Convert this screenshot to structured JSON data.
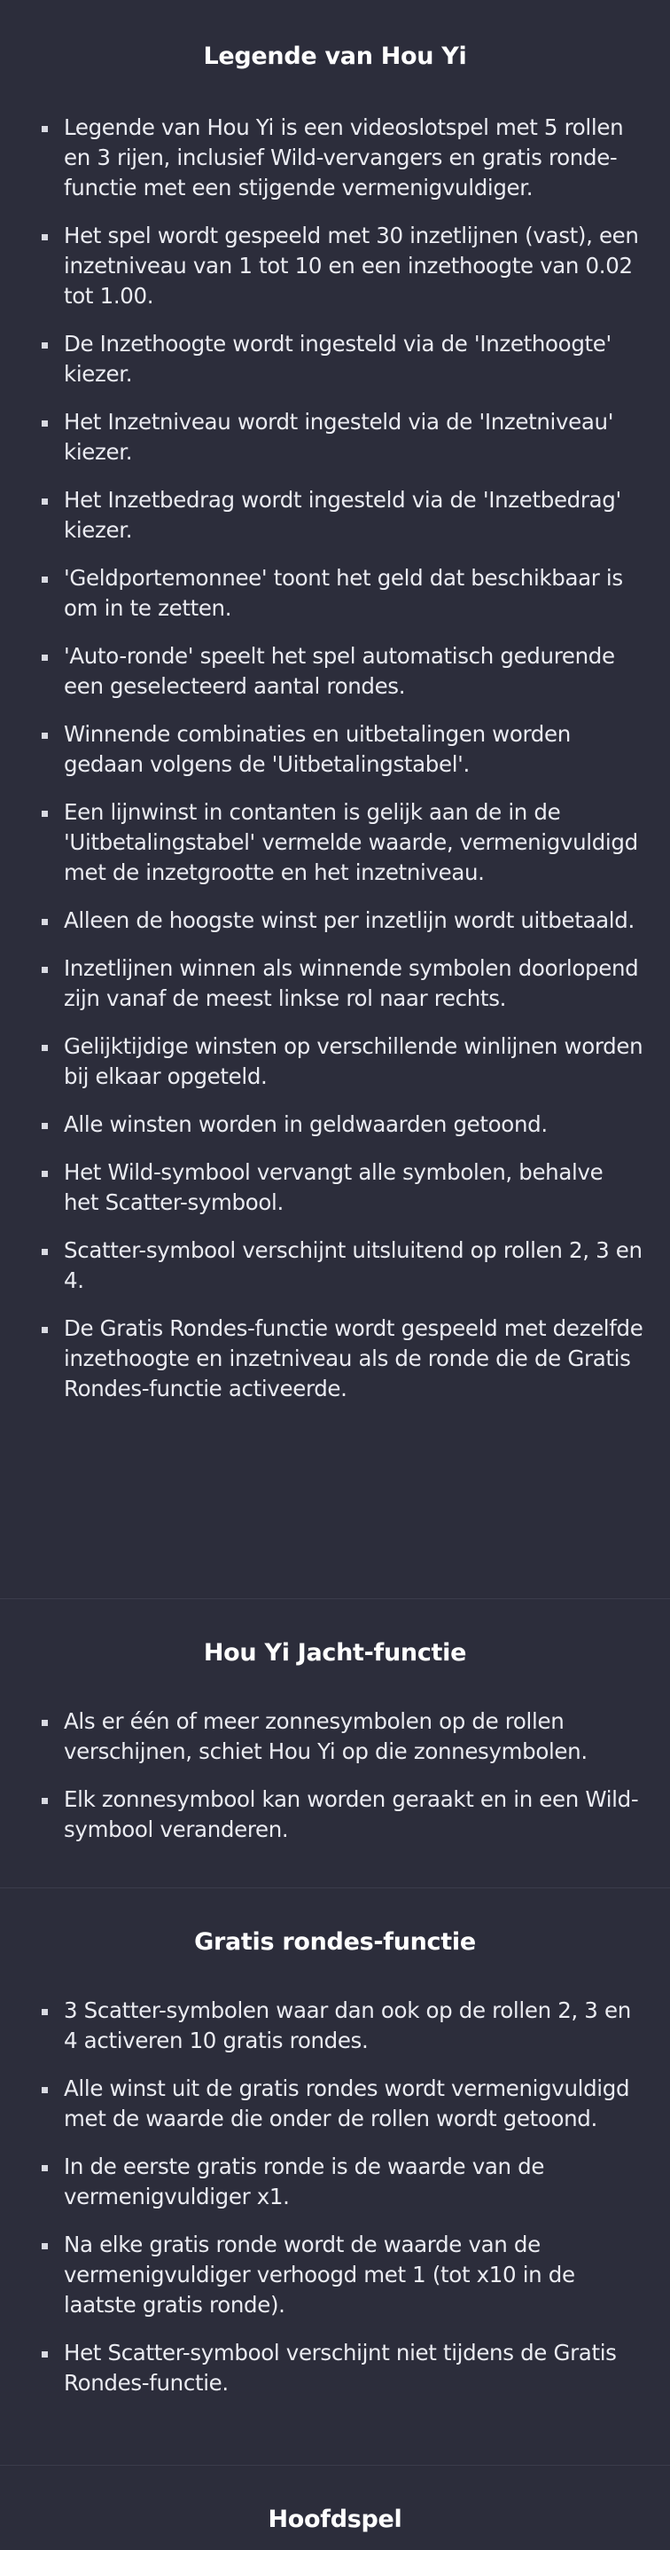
{
  "sections": {
    "legend": {
      "title": "Legende van Hou Yi",
      "items": [
        "Legende van Hou Yi is een videoslotspel met 5 rollen en 3 rijen, inclusief Wild-vervangers en gratis ronde-functie met een stijgende vermenigvuldiger.",
        "Het spel wordt gespeeld met 30 inzetlijnen (vast), een inzetniveau van 1 tot 10 en een inzethoogte van 0.02 tot 1.00.",
        "De Inzethoogte wordt ingesteld via de 'Inzethoogte' kiezer.",
        "Het Inzetniveau wordt ingesteld via de 'Inzetniveau' kiezer.",
        "Het Inzetbedrag wordt ingesteld via de 'Inzetbedrag' kiezer.",
        "'Geldportemonnee' toont het geld dat beschikbaar is om in te zetten.",
        "'Auto-ronde' speelt het spel automatisch gedurende een geselecteerd aantal rondes.",
        "Winnende combinaties en uitbetalingen worden gedaan volgens de 'Uitbetalingstabel'.",
        "Een lijnwinst in contanten is gelijk aan de in de 'Uitbetalingstabel' vermelde waarde, vermenigvuldigd met de inzetgrootte en het inzetniveau.",
        "Alleen de hoogste winst per inzetlijn wordt uitbetaald.",
        "Inzetlijnen winnen als winnende symbolen doorlopend zijn vanaf de meest linkse rol naar rechts.",
        "Gelijktijdige winsten op verschillende winlijnen worden bij elkaar opgeteld.",
        "Alle winsten worden in geldwaarden getoond.",
        "Het Wild-symbool vervangt alle symbolen, behalve het Scatter-symbool.",
        "Scatter-symbool verschijnt uitsluitend op rollen 2, 3 en 4.",
        "De Gratis Rondes-functie wordt gespeeld met dezelfde inzethoogte en inzetniveau als de ronde die de Gratis Rondes-functie activeerde."
      ]
    },
    "houyi": {
      "title": "Hou Yi Jacht-functie",
      "items": [
        "Als er één of meer zonnesymbolen op de rollen verschijnen, schiet Hou Yi op die zonnesymbolen.",
        "Elk zonnesymbool kan worden geraakt en in een Wild-symbool veranderen."
      ]
    },
    "free": {
      "title": "Gratis rondes-functie",
      "items": [
        "3 Scatter-symbolen waar dan ook op de rollen 2, 3 en 4 activeren 10 gratis rondes.",
        "Alle winst uit de gratis rondes wordt vermenigvuldigd met de waarde die onder de rollen wordt getoond.",
        "In de eerste gratis ronde is de waarde van de vermenigvuldiger x1.",
        "Na elke gratis ronde wordt de waarde van de vermenigvuldiger verhoogd met 1 (tot x10 in de laatste gratis ronde).",
        "Het Scatter-symbool verschijnt niet tijdens de Gratis Rondes-functie."
      ]
    },
    "main": {
      "title": "Hoofdspel"
    }
  }
}
